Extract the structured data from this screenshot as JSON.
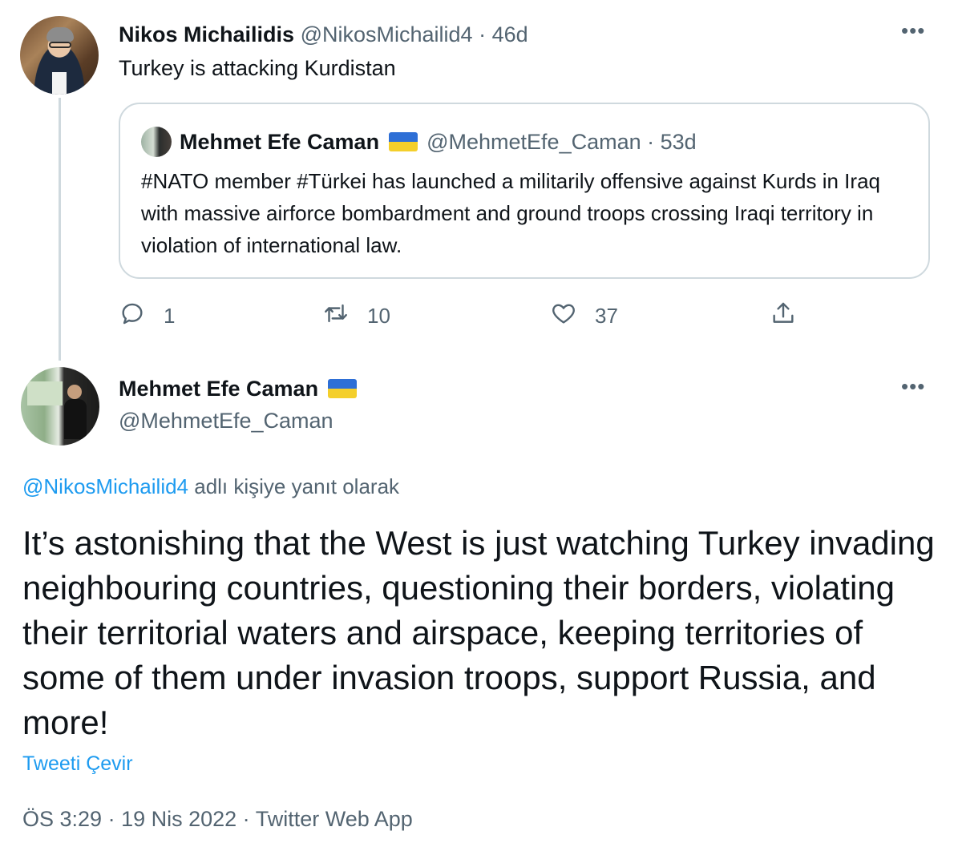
{
  "parent_tweet": {
    "author_name": "Nikos Michailidis",
    "author_handle": "@NikosMichailid4",
    "time_ago": "46d",
    "text": "Turkey is attacking Kurdistan",
    "quoted": {
      "author_name": "Mehmet Efe Caman",
      "author_handle": "@MehmetEfe_Caman",
      "time_ago": "53d",
      "text": "#NATO member #Türkei has launched a militarily offensive against Kurds in Iraq with massive airforce bombardment and ground troops crossing Iraqi territory in violation of international law."
    },
    "actions": {
      "reply_count": "1",
      "retweet_count": "10",
      "like_count": "37"
    }
  },
  "main_tweet": {
    "author_name": "Mehmet Efe Caman",
    "author_handle": "@MehmetEfe_Caman",
    "reply_mention": "@NikosMichailid4",
    "reply_suffix": " adlı kişiye yanıt olarak",
    "text": "It’s astonishing that the West is just watching Turkey invading neighbouring countries, questioning their borders, violating their territorial waters and airspace, keeping territories of some of them under invasion troops, support Russia, and more!",
    "translate_label": "Tweeti Çevir",
    "time": "ÖS 3:29",
    "date": "19 Nis 2022",
    "source": "Twitter Web App"
  },
  "ui": {
    "separator": " · ",
    "more": "•••",
    "flag_icon": "ukraine-flag-icon",
    "accent_color": "#1d9bf0",
    "secondary_text_color": "#536471"
  }
}
